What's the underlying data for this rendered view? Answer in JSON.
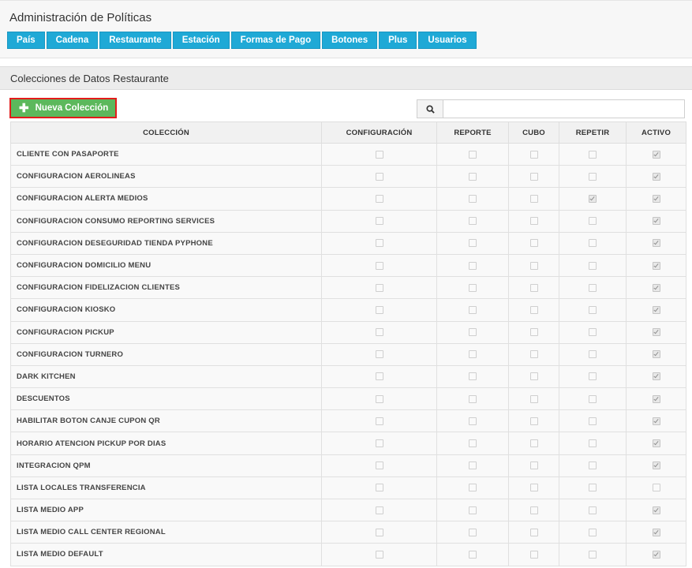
{
  "page": {
    "title": "Administración de Políticas"
  },
  "tabs": [
    "País",
    "Cadena",
    "Restaurante",
    "Estación",
    "Formas de Pago",
    "Botones",
    "Plus",
    "Usuarios"
  ],
  "section": {
    "title": "Colecciones de Datos Restaurante"
  },
  "toolbar": {
    "new_label": "Nueva Colección",
    "search_icon": "search-icon",
    "search_placeholder": "",
    "search_value": ""
  },
  "colors": {
    "tab": "#1fa9d6",
    "new_button": "#5cb85c",
    "highlight_border": "#e31b1b"
  },
  "table": {
    "headers": [
      "COLECCIÓN",
      "CONFIGURACIÓN",
      "REPORTE",
      "CUBO",
      "REPETIR",
      "ACTIVO"
    ],
    "rows": [
      {
        "name": "CLIENTE CON PASAPORTE",
        "configuracion": false,
        "reporte": false,
        "cubo": false,
        "repetir": false,
        "activo": true
      },
      {
        "name": "CONFIGURACION AEROLINEAS",
        "configuracion": false,
        "reporte": false,
        "cubo": false,
        "repetir": false,
        "activo": true
      },
      {
        "name": "CONFIGURACION ALERTA MEDIOS",
        "configuracion": false,
        "reporte": false,
        "cubo": false,
        "repetir": true,
        "activo": true
      },
      {
        "name": "CONFIGURACION CONSUMO REPORTING SERVICES",
        "configuracion": false,
        "reporte": false,
        "cubo": false,
        "repetir": false,
        "activo": true
      },
      {
        "name": "CONFIGURACION DESEGURIDAD TIENDA PYPHONE",
        "configuracion": false,
        "reporte": false,
        "cubo": false,
        "repetir": false,
        "activo": true
      },
      {
        "name": "CONFIGURACION DOMICILIO MENU",
        "configuracion": false,
        "reporte": false,
        "cubo": false,
        "repetir": false,
        "activo": true
      },
      {
        "name": "CONFIGURACION FIDELIZACION CLIENTES",
        "configuracion": false,
        "reporte": false,
        "cubo": false,
        "repetir": false,
        "activo": true
      },
      {
        "name": "CONFIGURACION KIOSKO",
        "configuracion": false,
        "reporte": false,
        "cubo": false,
        "repetir": false,
        "activo": true
      },
      {
        "name": "CONFIGURACION PICKUP",
        "configuracion": false,
        "reporte": false,
        "cubo": false,
        "repetir": false,
        "activo": true
      },
      {
        "name": "CONFIGURACION TURNERO",
        "configuracion": false,
        "reporte": false,
        "cubo": false,
        "repetir": false,
        "activo": true
      },
      {
        "name": "DARK KITCHEN",
        "configuracion": false,
        "reporte": false,
        "cubo": false,
        "repetir": false,
        "activo": true
      },
      {
        "name": "DESCUENTOS",
        "configuracion": false,
        "reporte": false,
        "cubo": false,
        "repetir": false,
        "activo": true
      },
      {
        "name": "HABILITAR BOTON CANJE CUPON QR",
        "configuracion": false,
        "reporte": false,
        "cubo": false,
        "repetir": false,
        "activo": true
      },
      {
        "name": "HORARIO ATENCION PICKUP POR DIAS",
        "configuracion": false,
        "reporte": false,
        "cubo": false,
        "repetir": false,
        "activo": true
      },
      {
        "name": "INTEGRACION QPM",
        "configuracion": false,
        "reporte": false,
        "cubo": false,
        "repetir": false,
        "activo": true
      },
      {
        "name": "LISTA LOCALES TRANSFERENCIA",
        "configuracion": false,
        "reporte": false,
        "cubo": false,
        "repetir": false,
        "activo": false
      },
      {
        "name": "LISTA MEDIO APP",
        "configuracion": false,
        "reporte": false,
        "cubo": false,
        "repetir": false,
        "activo": true
      },
      {
        "name": "LISTA MEDIO CALL CENTER REGIONAL",
        "configuracion": false,
        "reporte": false,
        "cubo": false,
        "repetir": false,
        "activo": true
      },
      {
        "name": "LISTA MEDIO DEFAULT",
        "configuracion": false,
        "reporte": false,
        "cubo": false,
        "repetir": false,
        "activo": true
      }
    ]
  }
}
